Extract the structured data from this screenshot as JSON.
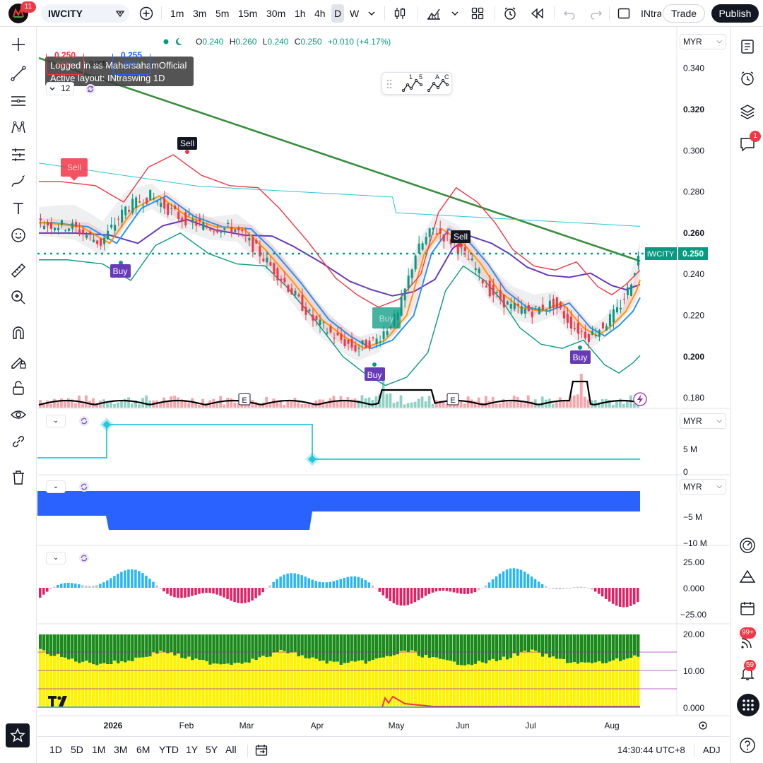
{
  "toolbar": {
    "notification_count": "11",
    "symbol": "IWCITY",
    "intervals": [
      "1m",
      "3m",
      "5m",
      "15m",
      "30m",
      "1h",
      "4h",
      "D",
      "W"
    ],
    "active_interval": "D",
    "layout_name_truncated": "INtra",
    "trade_label": "Trade",
    "publish_label": "Publish"
  },
  "tooltip": {
    "line1": "Logged in as MahersahamOfficial",
    "line2": "Active layout: INtraswing 1D"
  },
  "legend": {
    "o_label": "O",
    "o_value": "0.240",
    "h_label": "H",
    "h_value": "0.260",
    "l_label": "L",
    "l_value": "0.240",
    "c_label": "C",
    "c_value": "0.250",
    "change": "+0.010 (+4.17%)",
    "sell_price": "0.250",
    "sell_label": "SELL",
    "spread": "0.005",
    "buy_price": "0.255",
    "buy_label": "BUY",
    "interval_count": "12"
  },
  "wave_labels": [
    "1",
    "5",
    "A",
    "C"
  ],
  "currency": "MYR",
  "price_axis": [
    "0.340",
    "0.320",
    "0.300",
    "0.280",
    "0.260",
    "0.240",
    "0.220",
    "0.200",
    "0.180"
  ],
  "last_price_tag": {
    "symbol": "IWCITY",
    "price": "0.250"
  },
  "signal_labels": {
    "sell": "Sell",
    "buy": "Buy",
    "earnings": "E"
  },
  "pane2_axis": [
    "5 M",
    "0"
  ],
  "pane3_axis": [
    "−5 M",
    "−10 M"
  ],
  "pane4_axis": [
    "25.00",
    "0.000",
    "−25.00"
  ],
  "pane5_axis": [
    "20.00",
    "10.00",
    "0.000"
  ],
  "time_axis": [
    "2026",
    "Feb",
    "Mar",
    "Apr",
    "May",
    "Jun",
    "Jul",
    "Aug"
  ],
  "bottom": {
    "ranges": [
      "1D",
      "5D",
      "1M",
      "3M",
      "6M",
      "YTD",
      "1Y",
      "5Y",
      "All"
    ],
    "clock": "14:30:44 UTC+8",
    "adj": "ADJ"
  },
  "right_badges": {
    "chat": "1",
    "feeds": "99+",
    "alerts": "59"
  },
  "colors": {
    "up": "#089981",
    "down": "#f23645",
    "ma_blue": "#2196f3",
    "ma_orange": "#ff9800",
    "ma_purple": "#673ab7",
    "ma_green": "#388e3c",
    "cyan": "#26c6da",
    "signal_buy": "#673ab7",
    "signal_sell": "#131722",
    "histogram_up": "#29b6f6",
    "histogram_down": "#e91e63",
    "volume_profile_green": "#1b8a1b",
    "volume_profile_yellow": "#fff200",
    "blue_fill": "#2962ff"
  }
}
